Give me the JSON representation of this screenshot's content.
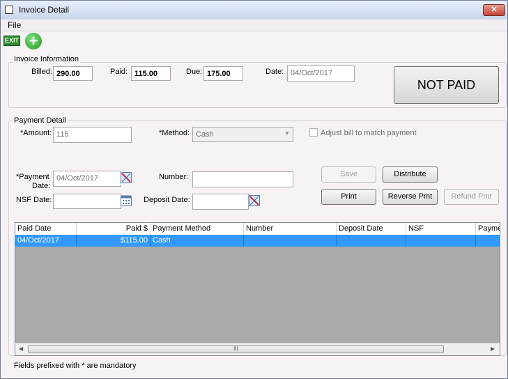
{
  "window": {
    "title": "Invoice Detail",
    "close_glyph": "✕"
  },
  "menu": {
    "file": "File"
  },
  "toolbar": {
    "exit_label": "EXIT",
    "add_glyph": "+"
  },
  "invoice_info": {
    "group_label": "Invoice Information",
    "billed_label": "Billed:",
    "billed_value": "290.00",
    "paid_label": "Paid:",
    "paid_value": "115.00",
    "due_label": "Due:",
    "due_value": "175.00",
    "date_label": "Date:",
    "date_value": "04/Oct/2017",
    "status": "NOT PAID"
  },
  "payment_detail": {
    "group_label": "Payment Detail",
    "amount_label": "*Amount:",
    "amount_value": "115",
    "method_label": "*Method:",
    "method_value": "Cash",
    "adjust_label": "Adjust bill to match payment",
    "payment_date_label_1": "*Payment",
    "payment_date_label_2": "Date:",
    "payment_date_value": "04/Oct/2017",
    "number_label": "Number:",
    "number_value": "",
    "nsf_date_label": "NSF Date:",
    "nsf_date_value": "",
    "deposit_date_label": "Deposit Date:",
    "deposit_date_value": ""
  },
  "buttons": {
    "save": "Save",
    "distribute": "Distribute",
    "print": "Print",
    "reverse": "Reverse Pmt",
    "refund": "Refund Pmt"
  },
  "grid": {
    "columns": [
      "Paid Date",
      "Paid $",
      "Payment Method",
      "Number",
      "Deposit Date",
      "NSF",
      "Payme"
    ],
    "rows": [
      [
        "04/Oct/2017",
        "$115.00",
        "Cash",
        "",
        "",
        "",
        ""
      ]
    ],
    "scroll_grip": "III"
  },
  "footer": {
    "note": "Fields prefixed with * are mandatory"
  },
  "colors": {
    "selected_row": "#3399ff",
    "grid_background": "#abaaab"
  }
}
